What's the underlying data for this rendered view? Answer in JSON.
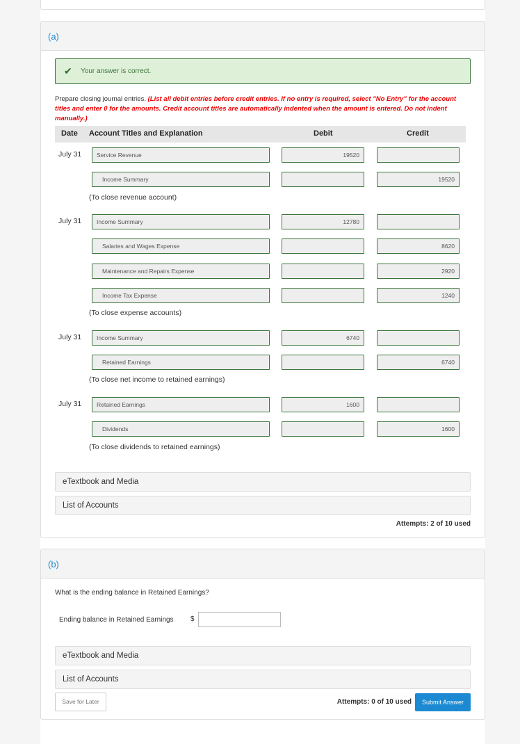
{
  "part_a": {
    "label": "(a)",
    "feedback": {
      "icon": "check-icon",
      "message": "Your answer is correct."
    },
    "instructions": {
      "lead": "Prepare closing journal entries.",
      "note": "(List all debit entries before credit entries. If no entry is required, select \"No Entry\" for the account titles and enter 0 for the amounts. Credit account titles are automatically indented when the amount is entered. Do not indent manually.)"
    },
    "table_headers": {
      "date": "Date",
      "account": "Account Titles and Explanation",
      "debit": "Debit",
      "credit": "Credit"
    },
    "entries": [
      {
        "date": "July 31",
        "lines": [
          {
            "account": "Service Revenue",
            "debit": "19520",
            "credit": ""
          },
          {
            "account": "Income Summary",
            "debit": "",
            "credit": "19520"
          }
        ],
        "explanation": "(To close revenue account)"
      },
      {
        "date": "July 31",
        "lines": [
          {
            "account": "Income Summary",
            "debit": "12780",
            "credit": ""
          },
          {
            "account": "Salaries and Wages Expense",
            "debit": "",
            "credit": "8620"
          },
          {
            "account": "Maintenance and Repairs Expense",
            "debit": "",
            "credit": "2920"
          },
          {
            "account": "Income Tax Expense",
            "debit": "",
            "credit": "1240"
          }
        ],
        "explanation": "(To close expense accounts)"
      },
      {
        "date": "July 31",
        "lines": [
          {
            "account": "Income Summary",
            "debit": "6740",
            "credit": ""
          },
          {
            "account": "Retained Earnings",
            "debit": "",
            "credit": "6740"
          }
        ],
        "explanation": "(To close net income to retained earnings)"
      },
      {
        "date": "July 31",
        "lines": [
          {
            "account": "Retained Earnings",
            "debit": "1600",
            "credit": ""
          },
          {
            "account": "Dividends",
            "debit": "",
            "credit": "1600"
          }
        ],
        "explanation": "(To close dividends to retained earnings)"
      }
    ],
    "etextbook_label": "eTextbook and Media",
    "list_accounts_label": "List of Accounts",
    "attempts": "Attempts: 2 of 10 used"
  },
  "part_b": {
    "label": "(b)",
    "question": "What is the ending balance in Retained Earnings?",
    "field_label": "Ending balance in Retained Earnings",
    "currency": "$",
    "field_value": "",
    "etextbook_label": "eTextbook and Media",
    "list_accounts_label": "List of Accounts",
    "save_label": "Save for Later",
    "attempts": "Attempts: 0 of 10 used",
    "submit_label": "Submit Answer"
  },
  "colors": {
    "accent_blue": "#1b8ad3",
    "success_green": "#3c763d",
    "success_bg": "#dff0d8",
    "instruction_red": "#e00000"
  }
}
